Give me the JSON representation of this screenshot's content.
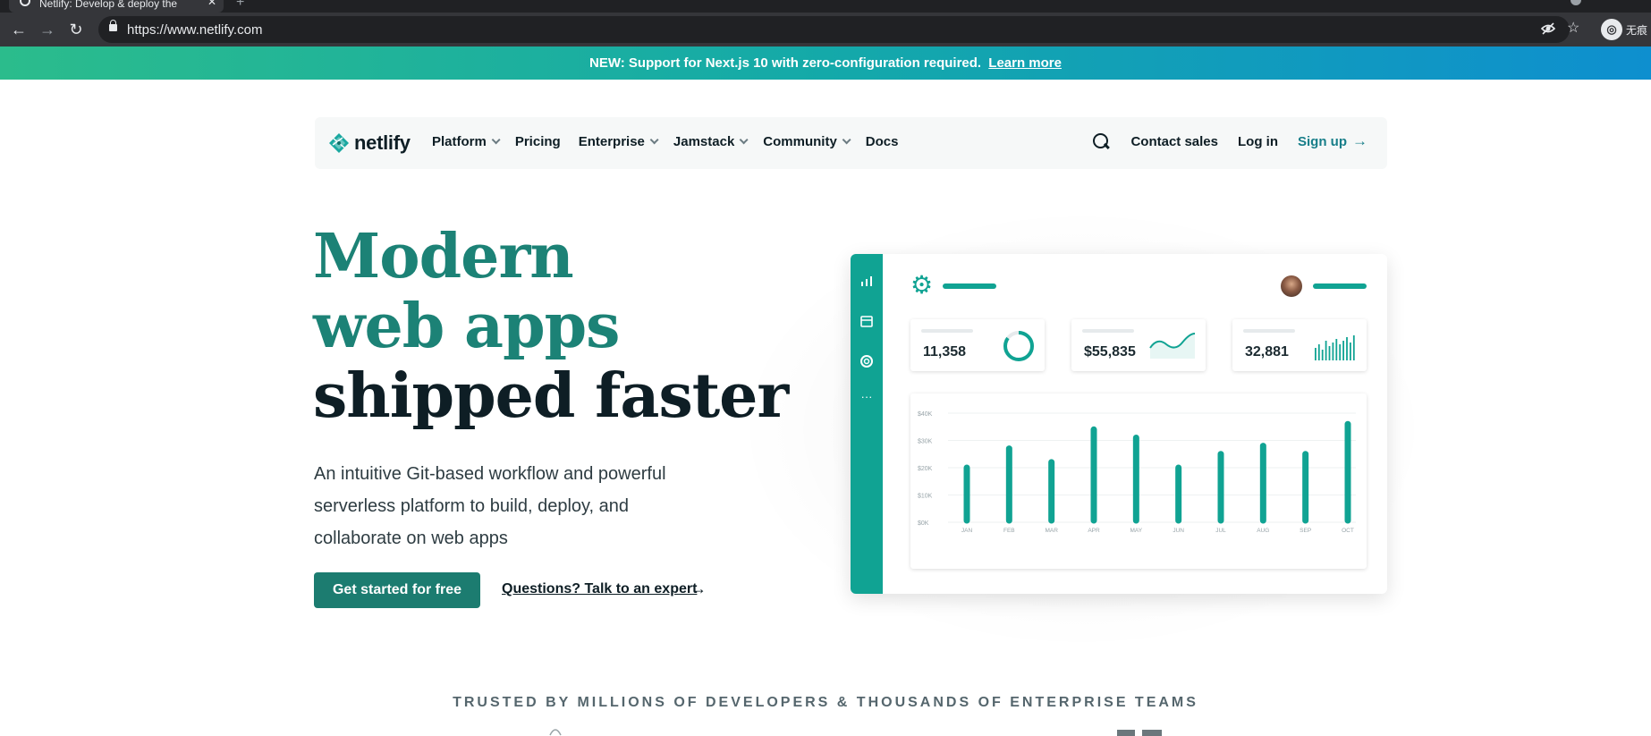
{
  "browser": {
    "tab_title": "Netlify: Develop & deploy the",
    "url": "https://www.netlify.com",
    "incognito_label": "无痕"
  },
  "announcement": {
    "text": "NEW: Support for Next.js 10 with zero-configuration required.",
    "link": "Learn more"
  },
  "nav": {
    "logo": "netlify",
    "items": [
      {
        "label": "Platform",
        "dropdown": true
      },
      {
        "label": "Pricing",
        "dropdown": false
      },
      {
        "label": "Enterprise",
        "dropdown": true
      },
      {
        "label": "Jamstack",
        "dropdown": true
      },
      {
        "label": "Community",
        "dropdown": true
      },
      {
        "label": "Docs",
        "dropdown": false
      }
    ],
    "contact": "Contact sales",
    "login": "Log in",
    "signup": "Sign up",
    "signup_arrow": "→"
  },
  "hero": {
    "line1": "Modern",
    "line2": "web apps",
    "line3": "shipped faster",
    "subtitle": "An intuitive Git-based workflow and powerful serverless platform to build, deploy, and collaborate on web apps",
    "cta_primary": "Get started for free",
    "cta_secondary": "Questions? Talk to an expert",
    "cta_secondary_arrow": "→"
  },
  "dashboard": {
    "stats": [
      {
        "value": "11,358",
        "widget": "donut",
        "ring_fraction": 0.85
      },
      {
        "value": "$55,835",
        "widget": "wave"
      },
      {
        "value": "32,881",
        "widget": "minibars"
      }
    ],
    "chart_data": {
      "type": "bar",
      "categories": [
        "JAN",
        "FEB",
        "MAR",
        "APR",
        "MAY",
        "JUN",
        "JUL",
        "AUG",
        "SEP",
        "OCT"
      ],
      "values": [
        20,
        27,
        22,
        34,
        31,
        20,
        25,
        28,
        25,
        36
      ],
      "ytick_labels": [
        "$40K",
        "$30K",
        "$20K",
        "$10K",
        "$0K"
      ],
      "ylim": [
        0,
        40
      ],
      "color": "#10a393",
      "grid": true
    }
  },
  "trusted": {
    "text": "TRUSTED BY MILLIONS OF DEVELOPERS & THOUSANDS OF ENTERPRISE TEAMS"
  },
  "colors": {
    "brand_teal": "#1c8276",
    "button_teal": "#1c7c70",
    "dashboard_teal": "#10a393",
    "dark_text": "#0e1e25"
  }
}
